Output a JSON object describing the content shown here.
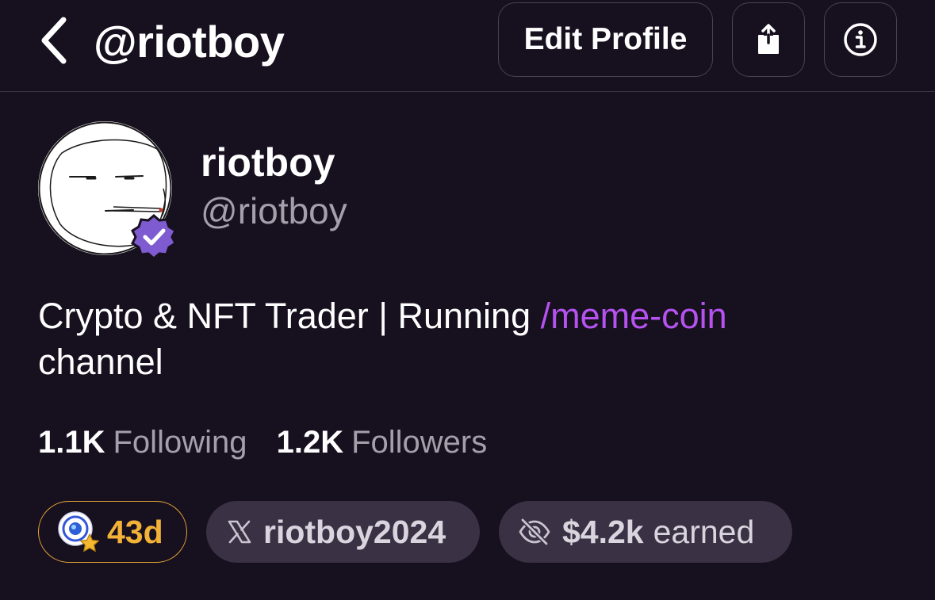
{
  "header": {
    "title": "@riotboy",
    "back_icon": "chevron-left-icon",
    "edit_profile_label": "Edit Profile",
    "share_icon": "share-icon",
    "info_icon": "info-icon"
  },
  "profile": {
    "display_name": "riotboy",
    "handle": "@riotboy",
    "verified": true,
    "verified_color": "#7e5bd0",
    "bio_text": "Crypto & NFT Trader | Running ",
    "bio_channel": "/meme-coin",
    "bio_suffix": "channel",
    "channel_color": "#b552f0"
  },
  "stats": {
    "following_count": "1.1K",
    "following_label": "Following",
    "followers_count": "1.2K",
    "followers_label": "Followers"
  },
  "chips": {
    "streak": {
      "icon": "streak-badge-icon",
      "text": "43d",
      "color": "#f2b137"
    },
    "x_account": {
      "icon": "x-logo-icon",
      "text": "riotboy2024"
    },
    "earned": {
      "icon": "eye-slash-icon",
      "amount": "$4.2k",
      "label": "earned"
    }
  }
}
